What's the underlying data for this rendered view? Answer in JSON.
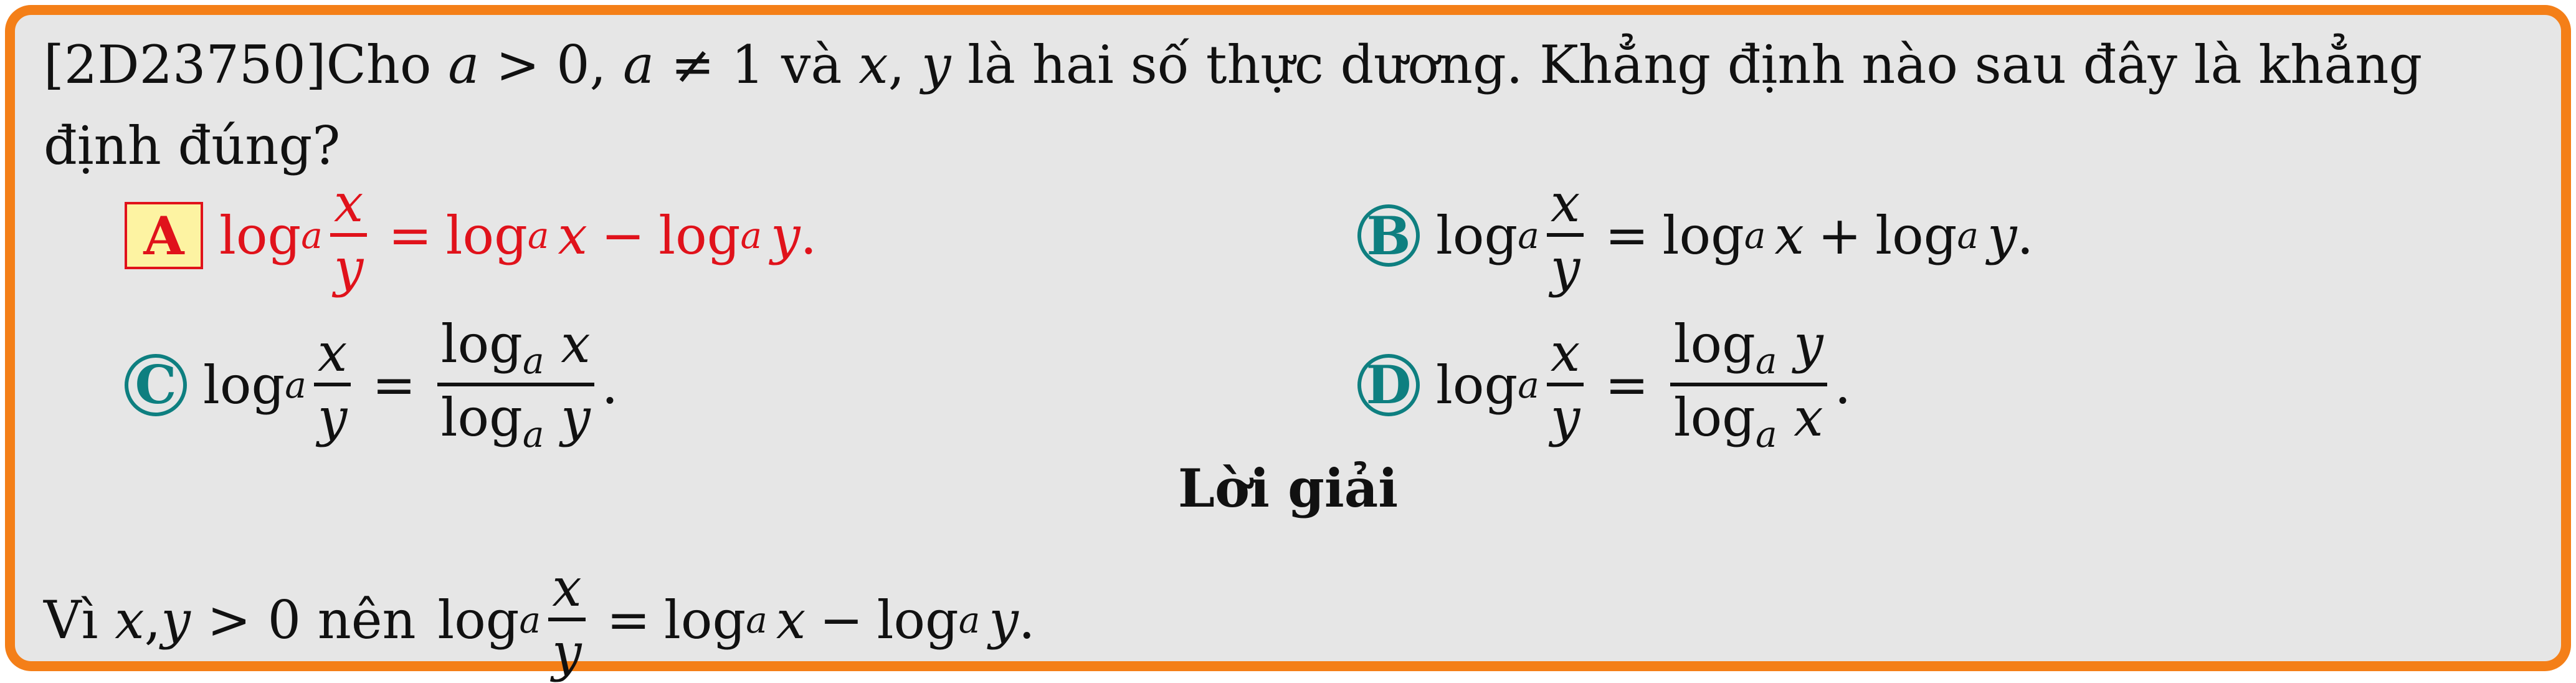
{
  "question": {
    "id": "[2D23750]",
    "text_line1_pre": "Cho ",
    "cond_a": "a",
    "gt": " > 0, ",
    "cond_a2": "a",
    "neq": " ≠ 1 và ",
    "var_x": "x",
    "comma": ", ",
    "var_y": "y",
    "text_line1_post": " là hai số thực dương. Khẳng định nào sau đây là khẳng",
    "text_line2": "định đúng?"
  },
  "math": {
    "log": "log",
    "base": "a",
    "x": "x",
    "y": "y",
    "eq": "=",
    "minus": "−",
    "plus": "+",
    "period": "."
  },
  "options": [
    {
      "label": "A",
      "selected": true
    },
    {
      "label": "B",
      "selected": false
    },
    {
      "label": "C",
      "selected": false
    },
    {
      "label": "D",
      "selected": false
    }
  ],
  "solution": {
    "title": "Lời giải",
    "pre": "Vì ",
    "x": "x",
    "comma": ", ",
    "y": "y",
    "cond": " > 0 nên "
  },
  "colors": {
    "frame": "#f47f18",
    "background": "#e6e6e6",
    "correct": "#e0121b",
    "badge_fill": "#fdf3a2",
    "badge_circle": "#0e7f80"
  }
}
